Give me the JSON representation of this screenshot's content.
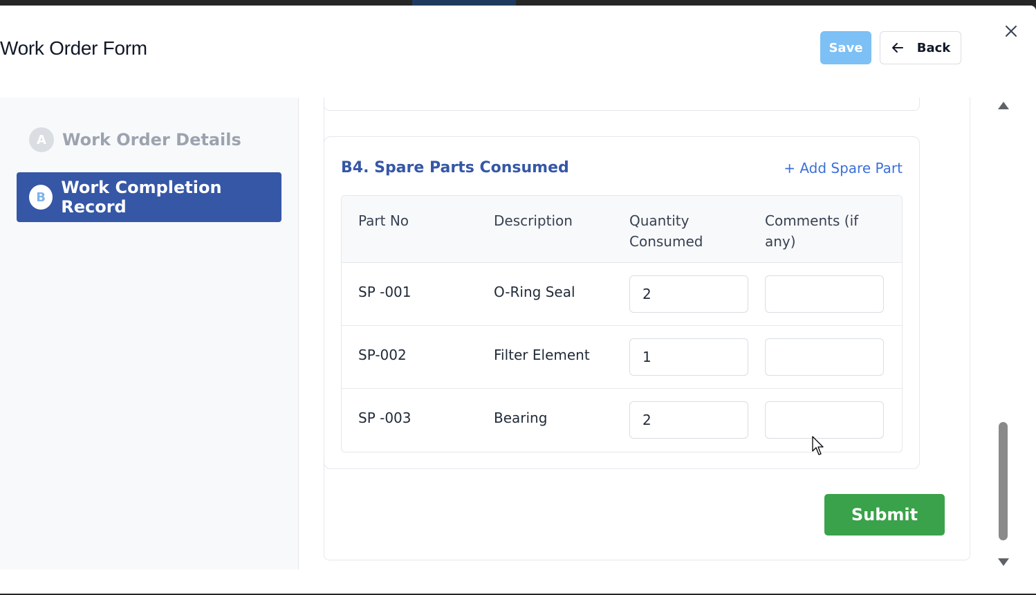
{
  "header": {
    "title": "Work Order Form",
    "save_label": "Save",
    "back_label": "Back"
  },
  "sidebar": {
    "steps": [
      {
        "badge": "A",
        "label": "Work Order Details",
        "active": false
      },
      {
        "badge": "B",
        "label": "Work Completion Record",
        "active": true
      }
    ]
  },
  "section": {
    "title": "B4. Spare Parts Consumed",
    "add_label": "+ Add Spare Part",
    "columns": [
      "Part No",
      "Description",
      "Quantity Consumed",
      "Comments (if any)"
    ],
    "rows": [
      {
        "part_no": "SP -001",
        "description": "O-Ring Seal",
        "quantity": "2",
        "comments": ""
      },
      {
        "part_no": "SP-002",
        "description": "Filter Element",
        "quantity": "1",
        "comments": ""
      },
      {
        "part_no": "SP -003",
        "description": "Bearing",
        "quantity": "2",
        "comments": ""
      }
    ]
  },
  "footer": {
    "submit_label": "Submit"
  },
  "colors": {
    "primary": "#3557a6",
    "save": "#7cc0f5",
    "submit": "#3aa24a",
    "link": "#3b6fd8"
  },
  "icons": [
    "arrow-left-icon",
    "close-icon",
    "scroll-up-arrow-icon",
    "scroll-down-arrow-icon",
    "mouse-cursor-icon"
  ]
}
